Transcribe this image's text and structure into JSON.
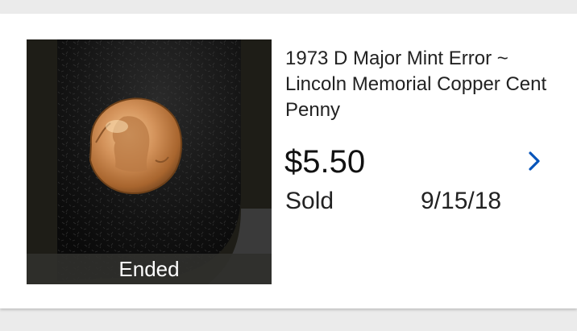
{
  "listing": {
    "title": "1973 D Major Mint Error ~ Lincoln Memorial Copper Cent Penny",
    "price": "$5.50",
    "status": "Sold",
    "date": "9/15/18",
    "image_overlay": "Ended",
    "image_subject": "copper Lincoln cent coin on black velvet"
  },
  "icons": {
    "chevron": "chevron-right-icon"
  },
  "colors": {
    "accent": "#0654ba",
    "card_background": "#ffffff",
    "page_background": "#ebebeb",
    "text": "#222222"
  }
}
